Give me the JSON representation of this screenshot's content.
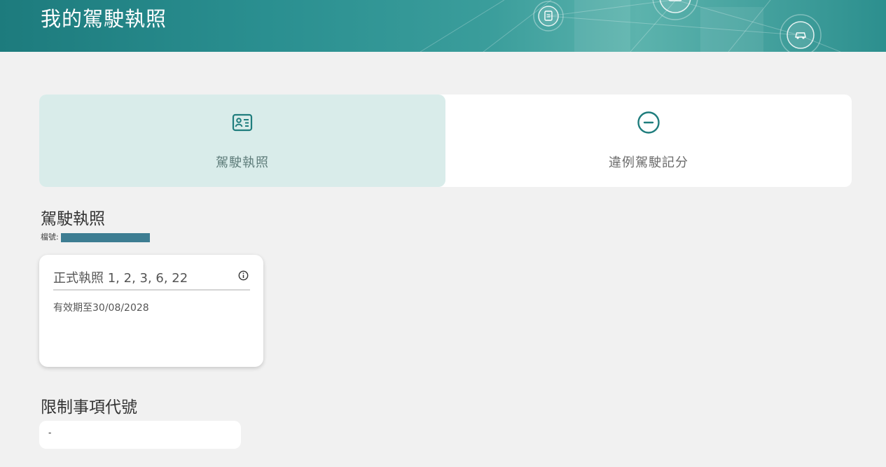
{
  "header": {
    "title": "我的駕駛執照",
    "decor_icons": [
      "document-icon",
      "id-card-icon",
      "car-icon"
    ]
  },
  "tabs": [
    {
      "label": "駕駛執照",
      "icon": "id-card-icon",
      "active": true
    },
    {
      "label": "違例駕駛記分",
      "icon": "minus-circle-icon",
      "active": false
    }
  ],
  "license_section": {
    "title": "駕駛執照",
    "file_label": "檔號:"
  },
  "license_card": {
    "type_label": "正式執照 1, 2, 3, 6, 22",
    "validity": "有效期至30/08/2028",
    "info_icon": "info-icon"
  },
  "restriction_section": {
    "title": "限制事項代號",
    "value": "-"
  },
  "colors": {
    "brand_teal": "#1f7d7d",
    "active_tab_bg": "#d9ecea",
    "page_bg": "#f1f1f1"
  }
}
